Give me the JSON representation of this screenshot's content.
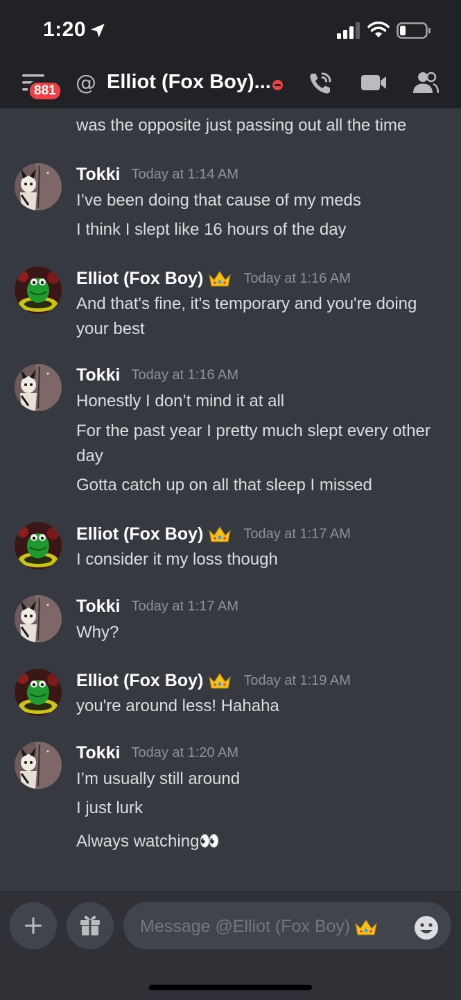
{
  "status_bar": {
    "time": "1:20"
  },
  "header": {
    "badge_count": "881",
    "at_symbol": "@",
    "title": "Elliot (Fox Boy)..."
  },
  "chat": {
    "partial_line": "was the opposite just passing out all the time",
    "groups": [
      {
        "author": "Tokki",
        "timestamp": "Today at 1:14 AM",
        "lines": [
          "I’ve been doing that cause of my meds",
          "I think I slept like 16 hours of the day"
        ]
      },
      {
        "author": "Elliot (Fox Boy)",
        "timestamp": "Today at 1:16 AM",
        "lines": [
          "And that's fine, it's temporary and you're doing your best"
        ]
      },
      {
        "author": "Tokki",
        "timestamp": "Today at 1:16 AM",
        "lines": [
          "Honestly I don’t mind it at all",
          "For the past year I pretty much slept every other day",
          "Gotta catch up on all that sleep I missed"
        ]
      },
      {
        "author": "Elliot (Fox Boy)",
        "timestamp": "Today at 1:17 AM",
        "lines": [
          "I consider it my loss though"
        ]
      },
      {
        "author": "Tokki",
        "timestamp": "Today at 1:17 AM",
        "lines": [
          "Why?"
        ]
      },
      {
        "author": "Elliot (Fox Boy)",
        "timestamp": "Today at 1:19 AM",
        "lines": [
          "you're around less! Hahaha"
        ]
      },
      {
        "author": "Tokki",
        "timestamp": "Today at 1:20 AM",
        "lines": [
          "I’m usually still around",
          "I just lurk",
          "Always watching👀"
        ]
      }
    ]
  },
  "composer": {
    "placeholder": "Message @Elliot (Fox Boy)"
  },
  "colors": {
    "background": "#36393f",
    "header": "#202225",
    "composer": "#2f3136",
    "badge": "#ed4245",
    "timestamp": "#8e9297"
  },
  "icons": {
    "status": [
      "location-arrow-icon",
      "signal-icon",
      "wifi-icon",
      "battery-icon"
    ],
    "header": [
      "menu-icon",
      "at-icon",
      "dnd-status-icon",
      "call-icon",
      "video-icon",
      "members-icon"
    ],
    "composer": [
      "plus-icon",
      "gift-icon",
      "emoji-icon"
    ],
    "decorative": [
      "crown-icon",
      "eyes-emoji"
    ]
  }
}
